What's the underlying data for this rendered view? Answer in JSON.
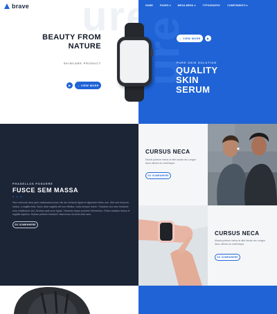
{
  "header": {
    "brand": "brave",
    "nav": [
      "HOME",
      "PAGES ▾",
      "MEGA MENU ▾",
      "TYPOGRAPHY",
      "COMPONENTS ▾"
    ]
  },
  "hero": {
    "ghost_left": "ure",
    "ghost_right": "ure",
    "headline": "BEAUTY FROM NATURE",
    "subline": "SKINCARE PRODUCT",
    "left_play": "▶",
    "left_button": "→ VIEW MORE",
    "right_button": "→ VIEW MORE",
    "right_play": "▶",
    "right_kicker": "PURE SKIN SOLUTION",
    "right_headline": "QUALITY SKIN SERUM"
  },
  "feature": {
    "kicker": "PHASELLUS POSUERE",
    "title": "FUSCE SEM MASSA",
    "dots": "• • •",
    "body": "Sem vehicula risus quis malesuada luctus nisl dui vehicula ligula et dignissim tellus non. Sed sed rhoncus metus, a sagittis felis. Nunc vitae sagittis elit non efficitur, nulla semper lorem. Tincidunt orci sem tincidunt eros vestibulum nisl. Aenean quis nunc ligula. Vivamus neque posuere fermentum. Etiam sodales lectus et sagittis dapibus. Nullam pretium tincidunt. Maecenas sit amet ante sem.",
    "button": "GO SOMEWHERE"
  },
  "cards": [
    {
      "title": "CURSUS NECA",
      "body": "Mauris pulvinar metus at nibh iaculis nec congue lacus ultrices ac scelerisque.",
      "button": "GO SOMEWHERE"
    },
    {
      "title": "CURSUS NECA",
      "body": "Mauris pulvinar metus at nibh iaculis nec congue lacus ultrices ac scelerisque.",
      "button": "GO SOMEWHERE"
    }
  ],
  "colors": {
    "accent": "#1f63d6",
    "dark": "#1c2536",
    "light": "#f4f6f8"
  }
}
